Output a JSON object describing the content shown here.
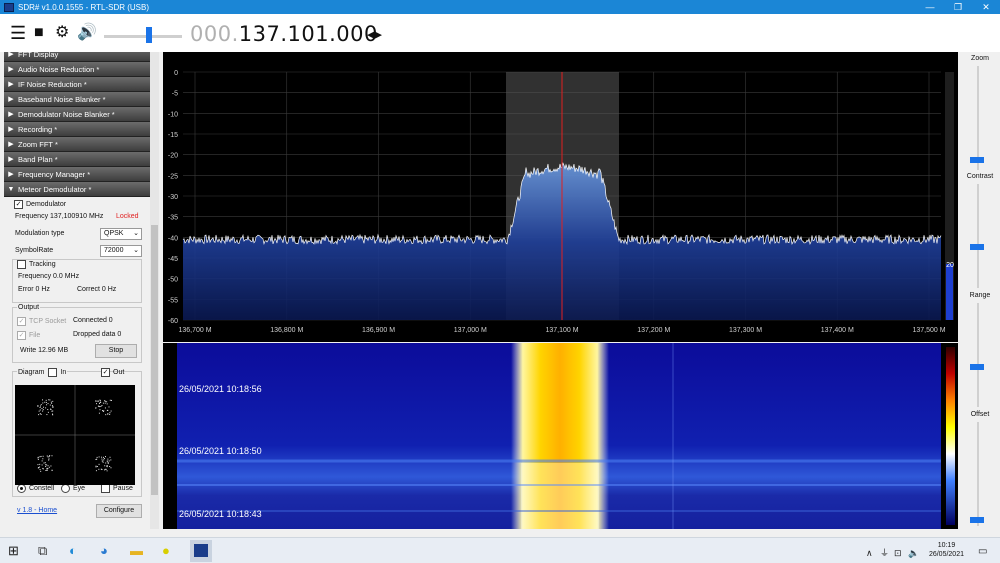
{
  "window": {
    "title": "SDR# v1.0.0.1555 - RTL-SDR (USB)",
    "minimize": "—",
    "maximize": "❐",
    "close": "✕"
  },
  "toolbar": {
    "freq_dim": "000.",
    "freq_bright": "137.101.000",
    "volume_level_percent": 55
  },
  "sections": [
    "FFT Display",
    "Audio Noise Reduction *",
    "IF Noise Reduction *",
    "Baseband Noise Blanker *",
    "Demodulator Noise Blanker *",
    "Recording *",
    "Zoom FFT *",
    "Band Plan *",
    "Frequency Manager *",
    "Meteor Demodulator *"
  ],
  "meteor": {
    "demodulator_label": "Demodulator",
    "frequency_label": "Frequency 137,100910 MHz",
    "locked": "Locked",
    "modulation_label": "Modulation type",
    "modulation_value": "QPSK",
    "symbolrate_label": "SymbolRate",
    "symbolrate_value": "72000",
    "tracking_label": "Tracking",
    "tracking_freq": "Frequency 0.0 MHz",
    "error": "Error 0 Hz",
    "correct": "Correct 0 Hz",
    "output_label": "Output",
    "tcp_socket": "TCP Socket",
    "connected": "Connected 0",
    "file": "File",
    "dropped": "Dropped data 0",
    "write": "Write 12.96 MB",
    "stop": "Stop",
    "diagram_label": "Diagram",
    "in_label": "In",
    "out_label": "Out",
    "constell": "Constell",
    "eye": "Eye",
    "pause": "Pause",
    "home_link": "v 1.8 - Home",
    "configure": "Configure"
  },
  "spectrum": {
    "y_ticks": [
      "0",
      "-5",
      "-10",
      "-15",
      "-20",
      "-25",
      "-30",
      "-35",
      "-40",
      "-45",
      "-50",
      "-55",
      "-60"
    ],
    "x_ticks": [
      "136,700 M",
      "136,800 M",
      "136,900 M",
      "137,000 M",
      "137,100 M",
      "137,200 M",
      "137,300 M",
      "137,400 M",
      "137,500 M"
    ],
    "side_value": "20"
  },
  "waterfall": {
    "timestamps": [
      "26/05/2021 10:18:56",
      "26/05/2021 10:18:50",
      "26/05/2021 10:18:43"
    ]
  },
  "rightpanel": {
    "zoom": "Zoom",
    "contrast": "Contrast",
    "range": "Range",
    "offset": "Offset"
  },
  "taskbar": {
    "time": "10:19",
    "date": "26/05/2021"
  },
  "colors": {
    "titlebar": "#1b86d6",
    "accent": "#1a73e8",
    "spectrum_bg": "#000000",
    "spectrum_fill": "#2a5aa8",
    "locked": "#e02020"
  }
}
